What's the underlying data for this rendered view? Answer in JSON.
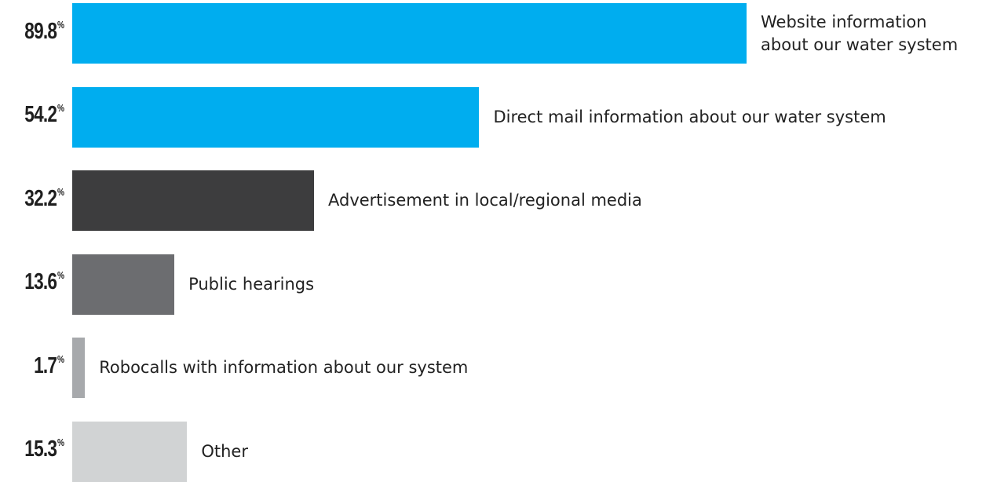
{
  "chart_data": {
    "type": "bar",
    "orientation": "horizontal",
    "title": "",
    "xlabel": "",
    "ylabel": "",
    "unit": "%",
    "xlim": [
      0,
      100
    ],
    "grid": false,
    "categories": [
      "Website information about our water system",
      "Direct mail information about our water system",
      "Advertisement in local/regional media",
      "Public hearings",
      "Robocalls with information about our system",
      "Other"
    ],
    "label_lines": [
      [
        "Website information",
        "about our water system"
      ],
      [
        "Direct mail information about our water system"
      ],
      [
        "Advertisement in local/regional media"
      ],
      [
        "Public hearings"
      ],
      [
        "Robocalls with information about our system"
      ],
      [
        "Other"
      ]
    ],
    "values": [
      89.8,
      54.2,
      32.2,
      13.6,
      1.7,
      15.3
    ],
    "value_labels": [
      "89.8",
      "54.2",
      "32.2",
      "13.6",
      "1.7",
      "15.3"
    ],
    "percent_sign": "%",
    "colors": [
      "#00adef",
      "#00adef",
      "#3d3d3e",
      "#6c6d70",
      "#a7a9ac",
      "#d1d3d4"
    ]
  }
}
